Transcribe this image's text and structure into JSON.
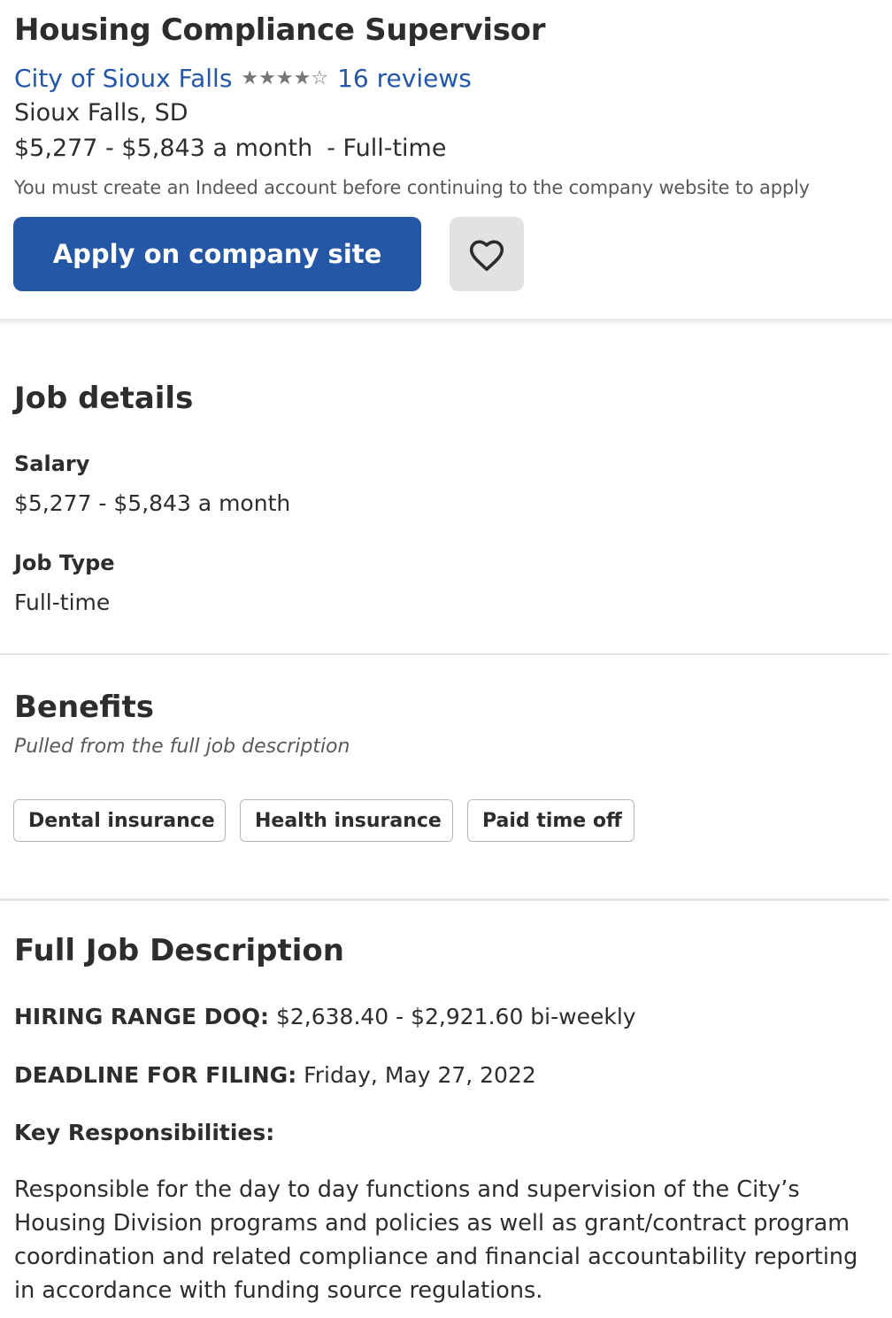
{
  "job": {
    "title": "Housing Compliance Supervisor",
    "company": "City of Sioux Falls",
    "rating_value": 4,
    "rating_max": 5,
    "reviews": "16 reviews",
    "location": "Sioux Falls, SD",
    "salary": "$5,277 - $5,843 a month",
    "job_type_suffix": "- Full-time",
    "notice": "You must create an Indeed account before continuing to the company website to apply",
    "apply_label": "Apply on company site",
    "save_icon": "heart-icon"
  },
  "details": {
    "title": "Job details",
    "salary_label": "Salary",
    "salary_value": "$5,277 - $5,843 a month",
    "type_label": "Job Type",
    "type_value": "Full-time"
  },
  "benefits": {
    "title": "Benefits",
    "subtitle": "Pulled from the full job description",
    "items": [
      "Dental insurance",
      "Health insurance",
      "Paid time off"
    ]
  },
  "description": {
    "title": "Full Job Description",
    "hiring_label": "HIRING RANGE DOQ:",
    "hiring_value": "$2,638.40 - $2,921.60 bi-weekly",
    "deadline_label": "DEADLINE FOR FILING:",
    "deadline_value": "Friday, May 27, 2022",
    "key_label": "Key Responsibilities:",
    "paragraph": "Responsible for the day to day functions and supervision of the City’s Housing Division programs and policies as well as grant/contract program coordination and related compliance and financial accountability reporting in accordance with funding source regulations."
  },
  "colors": {
    "brand_blue": "#2557a7",
    "text": "#2d2d2d",
    "muted": "#595959",
    "save_bg": "#e4e2e0"
  }
}
